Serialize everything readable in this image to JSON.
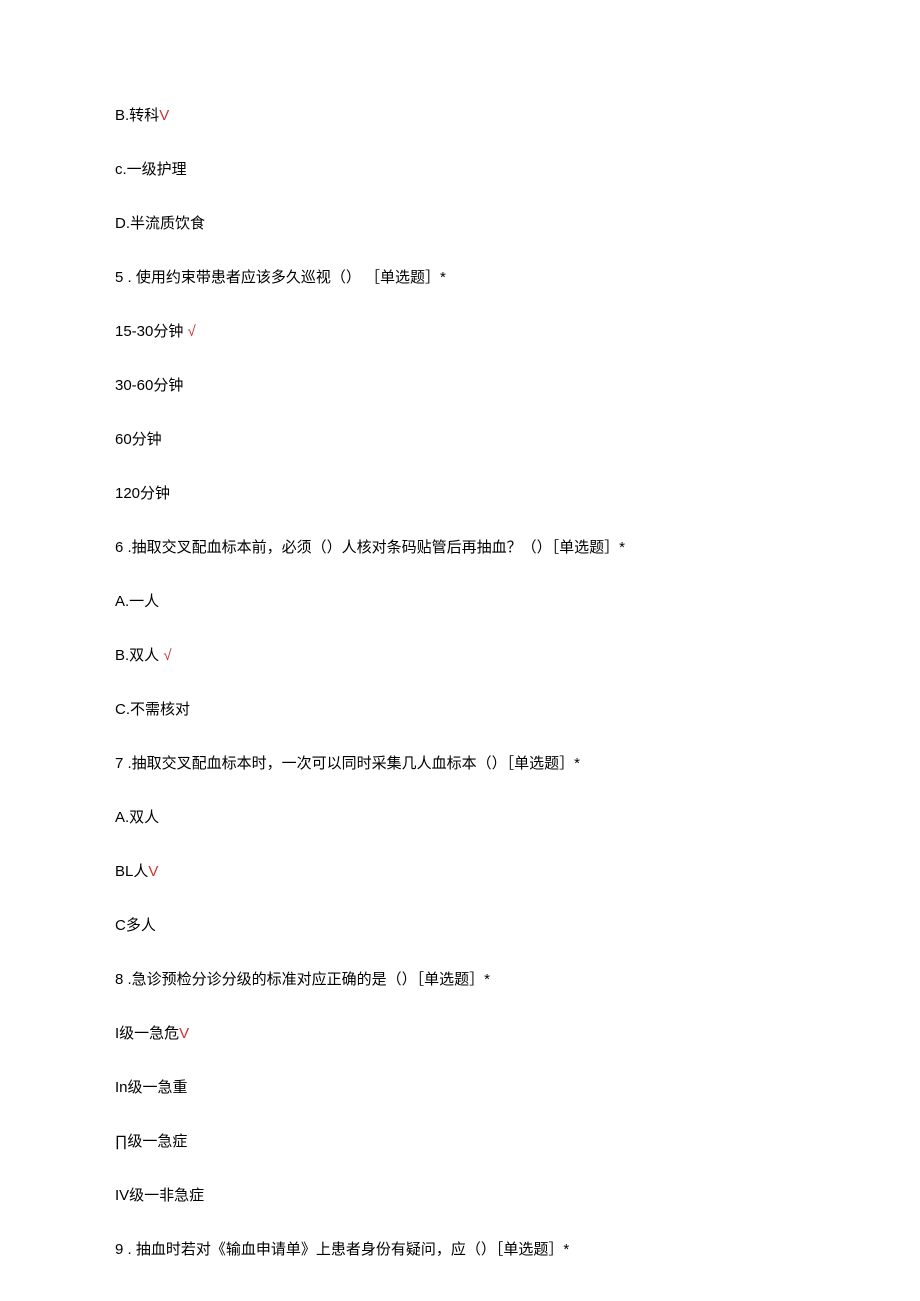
{
  "lines": [
    {
      "text": "B.转科",
      "mark": "V",
      "markClass": "check-red"
    },
    {
      "text": "c.一级护理",
      "mark": "",
      "markClass": ""
    },
    {
      "text": "D.半流质饮食",
      "mark": "",
      "markClass": ""
    },
    {
      "text": "5   . 使用约束带患者应该多久巡视（） ［单选题］*",
      "mark": "",
      "markClass": ""
    },
    {
      "text": "15-30分钟 ",
      "mark": "√",
      "markClass": "check-red"
    },
    {
      "text": "30-60分钟",
      "mark": "",
      "markClass": ""
    },
    {
      "text": "60分钟",
      "mark": "",
      "markClass": ""
    },
    {
      "text": "120分钟",
      "mark": "",
      "markClass": ""
    },
    {
      "text": "6   .抽取交叉配血标本前，必须（）人核对条码贴管后再抽血？（）［单选题］*",
      "mark": "",
      "markClass": ""
    },
    {
      "text": "A.一人",
      "mark": "",
      "markClass": ""
    },
    {
      "text": "B.双人 ",
      "mark": "√",
      "markClass": "check-red"
    },
    {
      "text": "C.不需核对",
      "mark": "",
      "markClass": ""
    },
    {
      "text": "7   .抽取交叉配血标本时，一次可以同时采集几人血标本（）［单选题］*",
      "mark": "",
      "markClass": ""
    },
    {
      "text": "A.双人",
      "mark": "",
      "markClass": ""
    },
    {
      "text": "BL人",
      "mark": "V",
      "markClass": "check-red"
    },
    {
      "text": "C多人",
      "mark": "",
      "markClass": ""
    },
    {
      "text": "8   .急诊预检分诊分级的标准对应正确的是（）［单选题］*",
      "mark": "",
      "markClass": ""
    },
    {
      "text": "I级一急危",
      "mark": "V",
      "markClass": "check-red"
    },
    {
      "text": "In级一急重",
      "mark": "",
      "markClass": ""
    },
    {
      "text": "∏级一急症",
      "mark": "",
      "markClass": ""
    },
    {
      "text": "IV级一非急症",
      "mark": "",
      "markClass": ""
    },
    {
      "text": "9   . 抽血时若对《输血申请单》上患者身份有疑问，应（）［单选题］*",
      "mark": "",
      "markClass": ""
    }
  ]
}
